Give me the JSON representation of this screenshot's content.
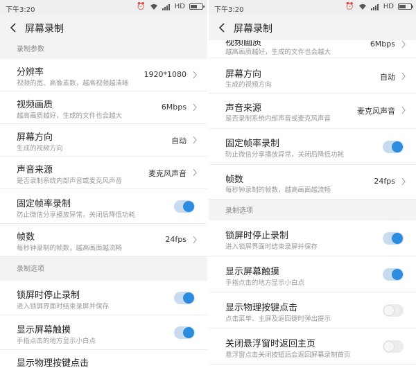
{
  "left": {
    "status_time": "下午3:20",
    "status_network": "HD",
    "title": "屏幕录制",
    "section_record_params": "录制参数",
    "resolution": {
      "label": "分辨率",
      "sub": "视频的宽、高像素数，越高视频越清晰",
      "value": "1920*1080"
    },
    "quality": {
      "label": "视频画质",
      "sub": "越高画质越好，生成的文件也会越大",
      "value": "6Mbps"
    },
    "orientation": {
      "label": "屏幕方向",
      "sub": "生成的视频方向",
      "value": "自动"
    },
    "audio": {
      "label": "声音来源",
      "sub": "是否录制系统内部声音或麦克风声音",
      "value": "麦克风声音"
    },
    "fixed_fps": {
      "label": "固定帧率录制",
      "sub": "防止微信分享播放异常，关闭后降低功耗",
      "on": true
    },
    "fps": {
      "label": "帧数",
      "sub": "每秒钟录制的帧数，越高画面越流畅",
      "value": "24fps"
    },
    "section_record_options": "录制选项",
    "lock_stop": {
      "label": "锁屏时停止录制",
      "sub": "进入锁屏界面时结束录屏并保存",
      "on": true
    },
    "show_touch": {
      "label": "显示屏幕触摸",
      "sub": "手指点击的地方显示小白点",
      "on": true
    },
    "show_keys": {
      "label": "显示物理按键点击"
    }
  },
  "right": {
    "status_time": "下午3:20",
    "status_network": "HD",
    "title": "屏幕录制",
    "quality": {
      "label": "视频画质",
      "sub": "越高画质越好，生成的文件也会越大",
      "value": "6Mbps"
    },
    "orientation": {
      "label": "屏幕方向",
      "sub": "生成的视频方向",
      "value": "自动"
    },
    "audio": {
      "label": "声音来源",
      "sub": "是否录制系统内部声音或麦克风声音",
      "value": "麦克风声音"
    },
    "fixed_fps": {
      "label": "固定帧率录制",
      "sub": "防止微信分享播放异常，关闭后降低功耗",
      "on": true
    },
    "fps": {
      "label": "帧数",
      "sub": "每秒钟录制的帧数，越高画面越流畅",
      "value": "24fps"
    },
    "section_record_options": "录制选项",
    "lock_stop": {
      "label": "锁屏时停止录制",
      "sub": "进入锁屏界面时结束录屏并保存",
      "on": true
    },
    "show_touch": {
      "label": "显示屏幕触摸",
      "sub": "手指点击的地方显示小白点",
      "on": true
    },
    "show_keys": {
      "label": "显示物理按键点击",
      "sub": "点击菜单、主屏及返回键时弹出提示",
      "on": false
    },
    "close_float": {
      "label": "关闭悬浮窗时返回主页",
      "sub": "悬浮窗点击关闭按钮后会返回屏幕录制首页",
      "on": false
    }
  },
  "colors": {
    "accent": "#2d8be0",
    "header_bg": "#f3f3f3",
    "section_bg": "#f3f3f3"
  }
}
